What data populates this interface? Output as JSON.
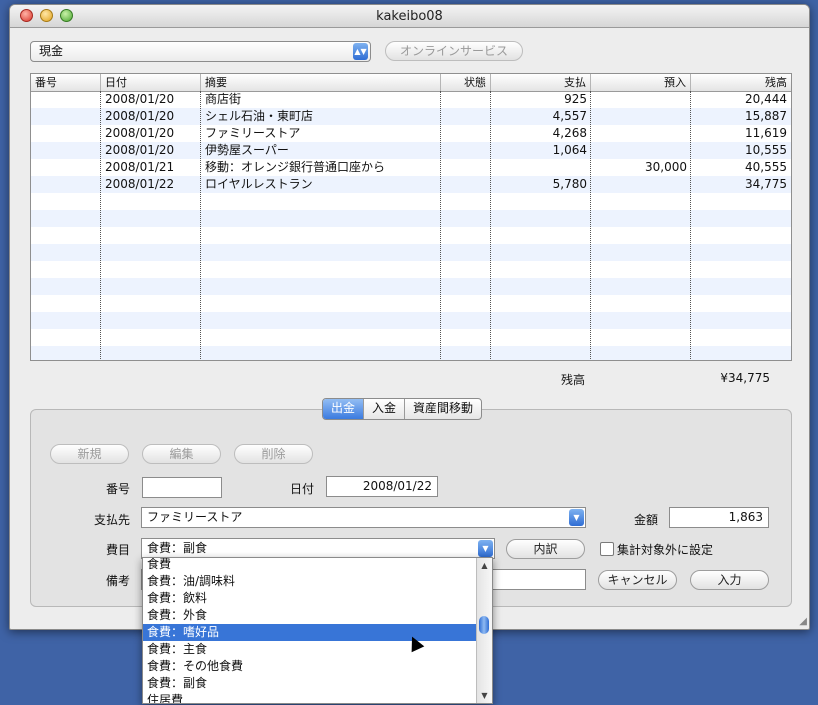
{
  "window": {
    "title": "kakeibo08"
  },
  "account": {
    "selected": "現金",
    "online_button": "オンラインサービス"
  },
  "table": {
    "headers": [
      "番号",
      "日付",
      "摘要",
      "状態",
      "支払",
      "預入",
      "残高"
    ],
    "rows": [
      {
        "no": "",
        "date": "2008/01/20",
        "desc": "商店街",
        "status": "",
        "pay": "925",
        "dep": "",
        "bal": "20,444"
      },
      {
        "no": "",
        "date": "2008/01/20",
        "desc": "シェル石油・東町店",
        "status": "",
        "pay": "4,557",
        "dep": "",
        "bal": "15,887"
      },
      {
        "no": "",
        "date": "2008/01/20",
        "desc": "ファミリーストア",
        "status": "",
        "pay": "4,268",
        "dep": "",
        "bal": "11,619"
      },
      {
        "no": "",
        "date": "2008/01/20",
        "desc": "伊勢屋スーパー",
        "status": "",
        "pay": "1,064",
        "dep": "",
        "bal": "10,555"
      },
      {
        "no": "",
        "date": "2008/01/21",
        "desc": "移動：オレンジ銀行普通口座から",
        "status": "",
        "pay": "",
        "dep": "30,000",
        "bal": "40,555"
      },
      {
        "no": "",
        "date": "2008/01/22",
        "desc": "ロイヤルレストラン",
        "status": "",
        "pay": "5,780",
        "dep": "",
        "bal": "34,775"
      }
    ]
  },
  "balance": {
    "label": "残高",
    "value": "¥34,775"
  },
  "tabs": [
    "出金",
    "入金",
    "資産間移動"
  ],
  "form": {
    "new_button": "新規",
    "edit_button": "編集",
    "delete_button": "削除",
    "number_label": "番号",
    "number_value": "",
    "date_label": "日付",
    "date_value": "2008/01/22",
    "payee_label": "支払先",
    "payee_value": "ファミリーストア",
    "amount_label": "金額",
    "amount_value": "1,863",
    "category_label": "費目",
    "category_value": "食費：副食",
    "breakdown_button": "内訳",
    "exclude_label": "集計対象外に設定",
    "memo_label": "備考",
    "memo_value": "",
    "cancel_button": "キャンセル",
    "enter_button": "入力"
  },
  "dropdown": {
    "items": [
      "食費",
      "食費：油/調味料",
      "食費：飲料",
      "食費：外食",
      "食費：嗜好品",
      "食費：主食",
      "食費：その他食費",
      "食費：副食",
      "住居費"
    ],
    "highlighted": "食費：嗜好品"
  }
}
